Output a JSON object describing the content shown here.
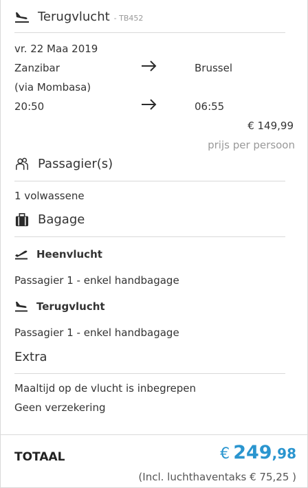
{
  "return_flight": {
    "title": "Terugvlucht",
    "code": "- TB452",
    "date": "vr. 22 Maa 2019",
    "origin": "Zanzibar",
    "via": "(via Mombasa)",
    "destination": "Brussel",
    "depart_time": "20:50",
    "arrive_time": "06:55",
    "price": "€ 149,99",
    "price_note": "prijs per persoon"
  },
  "passengers": {
    "title": "Passagier(s)",
    "summary": "1 volwassene"
  },
  "baggage": {
    "title": "Bagage",
    "outbound_label": "Heenvlucht",
    "outbound_detail": "Passagier 1 - enkel handbagage",
    "return_label": "Terugvlucht",
    "return_detail": "Passagier 1 - enkel handbagage"
  },
  "extra": {
    "title": "Extra",
    "items": [
      "Maaltijd op de vlucht is inbegrepen",
      "Geen verzekering"
    ]
  },
  "total": {
    "label": "TOTAAL",
    "currency": "€",
    "integer": "249",
    "decimal": ",98",
    "note": "(Incl. luchthaventaks € 75,25 )"
  },
  "colors": {
    "accent": "#2a95cf",
    "text": "#333333",
    "muted": "#999999",
    "rule": "#d9d9d9"
  },
  "icons": {
    "return": "plane-landing-icon",
    "passengers": "passengers-icon",
    "baggage": "suitcase-icon"
  }
}
